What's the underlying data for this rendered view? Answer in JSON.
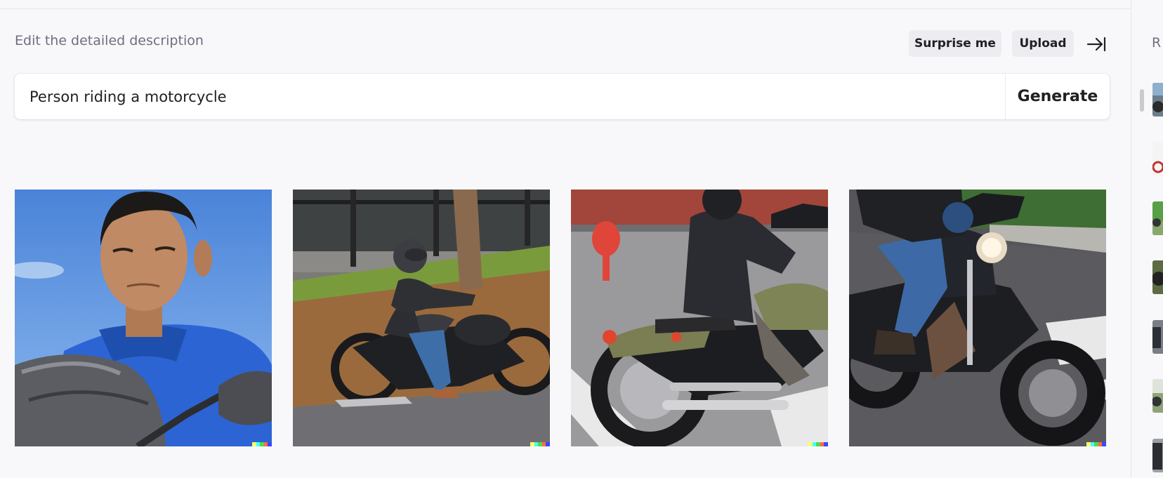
{
  "editor": {
    "description_label": "Edit the detailed description",
    "surprise_label": "Surprise me",
    "upload_label": "Upload",
    "prompt_value": "Person riding a motorcycle",
    "generate_label": "Generate"
  },
  "results": [
    {
      "caption": "Man in blue shirt beside a motorcycle under blue sky"
    },
    {
      "caption": "Rider in black helmet on a black motorcycle near a tree"
    },
    {
      "caption": "Rider in leather jacket on an olive green motorcycle"
    },
    {
      "caption": "Rider in jeans on a black motorcycle with headlight"
    }
  ],
  "sidebar": {
    "title_initial": "R",
    "history_count": 7
  },
  "colors": {
    "page_bg": "#f8f8fa",
    "pill_bg": "#ececf1",
    "label_gray": "#6e6e80",
    "signature": [
      "#ffff66",
      "#42ffff",
      "#51da4c",
      "#ff6e3c",
      "#3c46ff"
    ]
  }
}
